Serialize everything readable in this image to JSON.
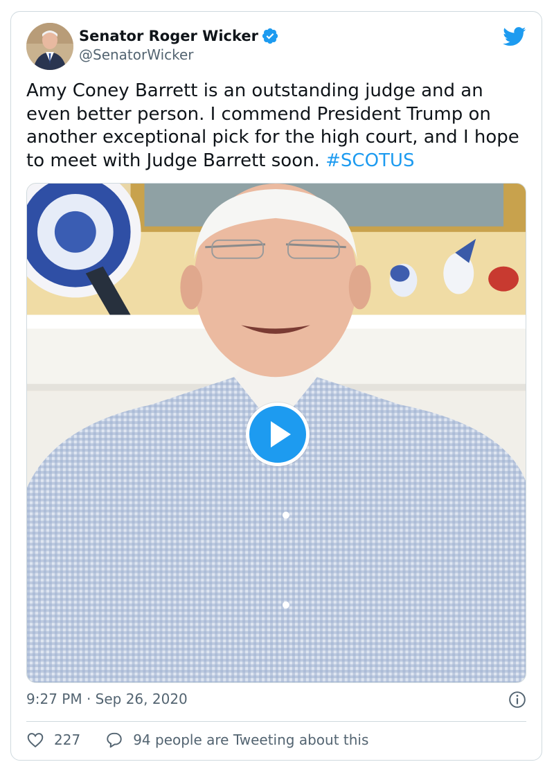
{
  "tweet": {
    "author": {
      "name": "Senator Roger Wicker",
      "handle": "@SenatorWicker",
      "verified": true
    },
    "text_main": "Amy Coney Barrett is an outstanding judge and an even better person. I commend President Trump on another exceptional pick for the high court, and I hope to meet with Judge Barrett soon.",
    "hashtag": "#SCOTUS",
    "timestamp": "9:27 PM · Sep 26, 2020",
    "likes": "227",
    "conversation": "94 people are Tweeting about this"
  },
  "colors": {
    "accent": "#1d9bf0",
    "text_primary": "#0f1419",
    "text_secondary": "#536471",
    "border": "#cfd9de"
  },
  "icons": [
    "verified-badge-icon",
    "twitter-bird-icon",
    "play-icon",
    "info-icon",
    "heart-icon",
    "reply-bubble-icon"
  ]
}
